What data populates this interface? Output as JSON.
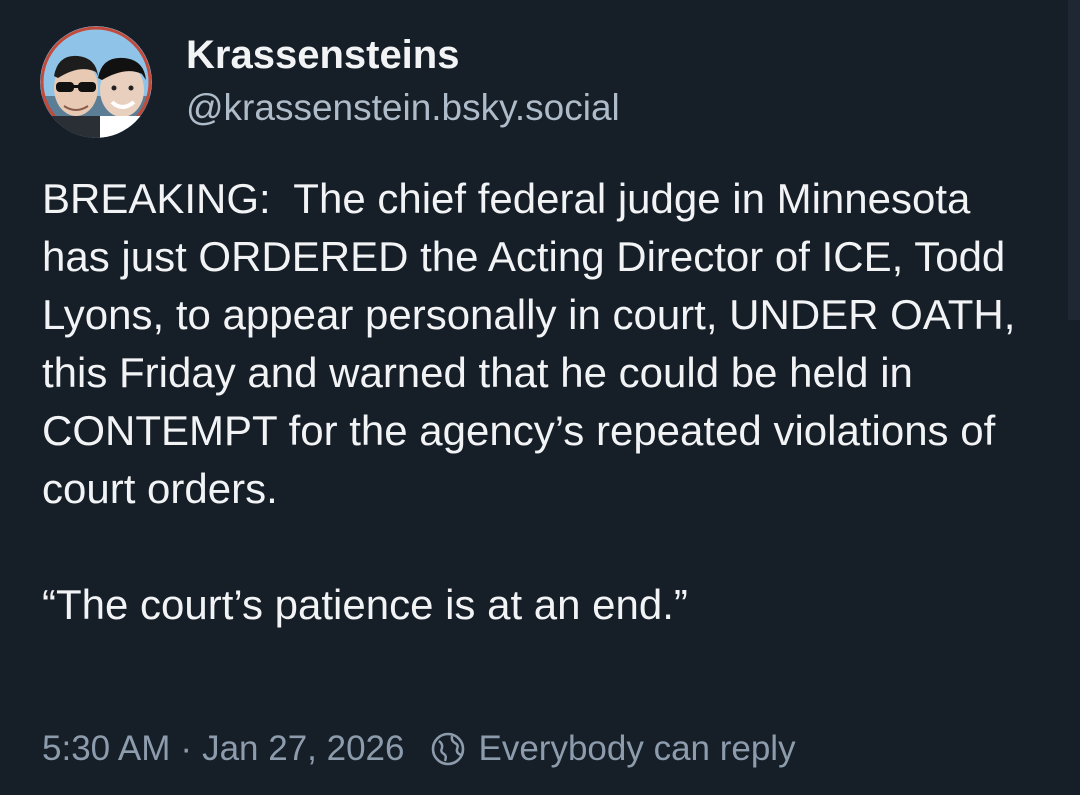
{
  "author": {
    "display_name": "Krassensteins",
    "handle": "@krassenstein.bsky.social",
    "avatar_icon": "avatar-two-men-photo"
  },
  "post": {
    "paragraph_1": "BREAKING:  The chief federal judge in Minnesota has just ORDERED the Acting Director of ICE, Todd Lyons, to appear personally in court, UNDER OATH, this Friday and warned that he could be held in CONTEMPT for the agency’s repeated violations of court orders.",
    "paragraph_2": "“The court’s patience is at an end.”"
  },
  "meta": {
    "time": "5:30 AM",
    "separator": "·",
    "date": "Jan 27, 2026",
    "reply_icon": "globe-icon",
    "reply_setting": "Everybody can reply"
  },
  "colors": {
    "background": "#161e27",
    "text": "#f1f3f5",
    "handle": "#aebbc9",
    "meta": "#8d9cad"
  }
}
